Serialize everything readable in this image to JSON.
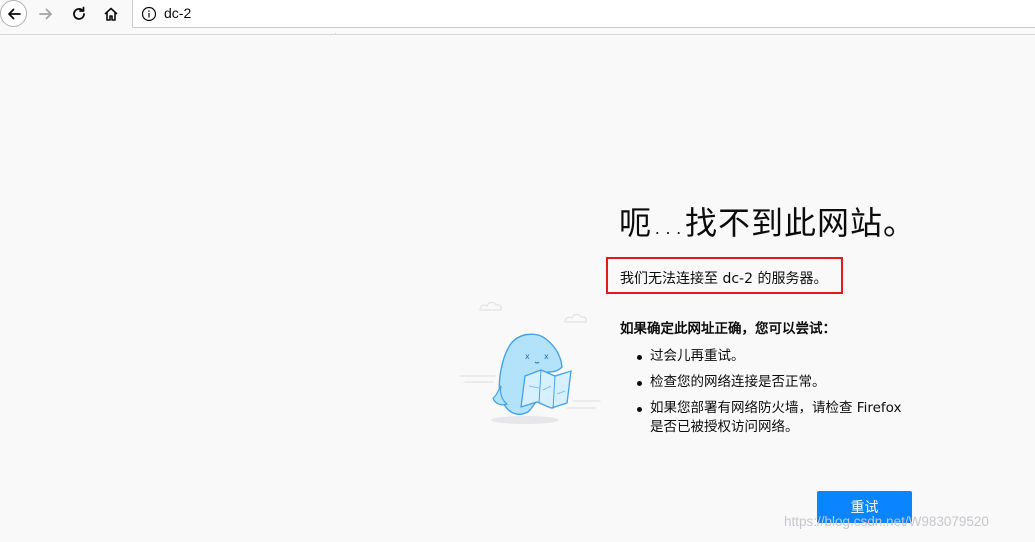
{
  "toolbar": {
    "url": "dc-2"
  },
  "error": {
    "title": "呃…找不到此网站。",
    "description": "我们无法连接至 dc-2 的服务器。",
    "suggest_title": "如果确定此网址正确，您可以尝试：",
    "suggestions": [
      "过会儿再重试。",
      "检查您的网络连接是否正常。",
      "如果您部署有网络防火墙，请检查 Firefox 是否已被授权访问网络。"
    ],
    "try_again_label": "重试"
  },
  "watermark": "https://blog.csdn.net/W983079520",
  "colors": {
    "accent": "#0a84ff",
    "highlight_box": "#e31b1b",
    "background": "#f9f9fa"
  }
}
